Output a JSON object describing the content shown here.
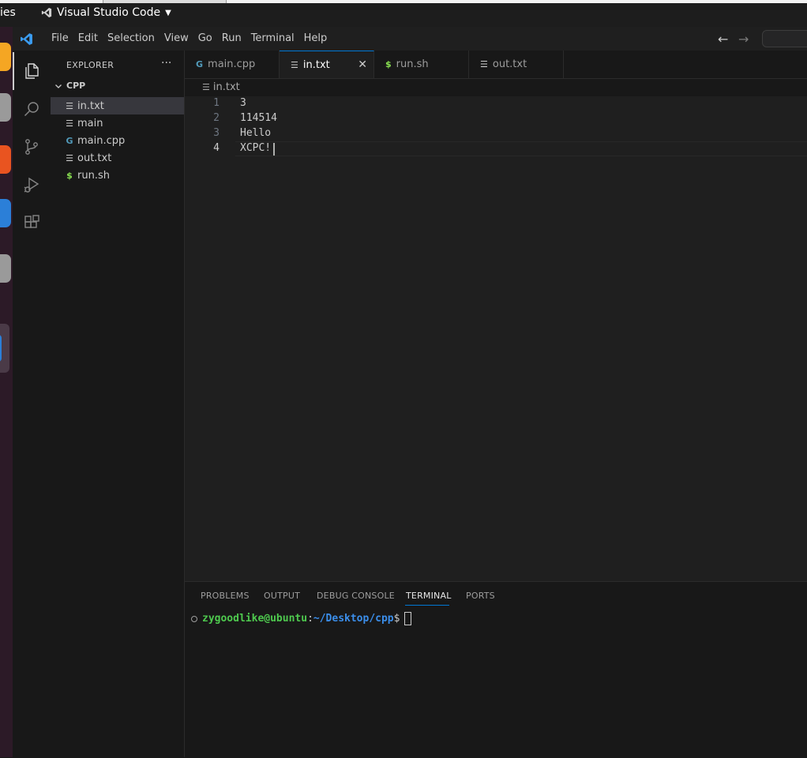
{
  "os": {
    "activities_label": "ies",
    "app_name": "Visual Studio Code",
    "dock_colors": [
      "#f5a623",
      "#9a9a9a",
      "#e95420",
      "#2b7fd8",
      "#9a9a9a",
      "#2b7fd8"
    ]
  },
  "menu": [
    "File",
    "Edit",
    "Selection",
    "View",
    "Go",
    "Run",
    "Terminal",
    "Help"
  ],
  "activity_bar": [
    "files-icon",
    "search-icon",
    "source-control-icon",
    "run-debug-icon",
    "extensions-icon"
  ],
  "explorer": {
    "title": "EXPLORER",
    "more": "···",
    "folder": "CPP",
    "files": [
      {
        "name": "in.txt",
        "icon": "text-file-icon",
        "selected": true
      },
      {
        "name": "main",
        "icon": "text-file-icon",
        "selected": false
      },
      {
        "name": "main.cpp",
        "icon": "cpp-file-icon",
        "selected": false
      },
      {
        "name": "out.txt",
        "icon": "text-file-icon",
        "selected": false
      },
      {
        "name": "run.sh",
        "icon": "shell-file-icon",
        "selected": false
      }
    ]
  },
  "tabs": [
    {
      "label": "main.cpp",
      "icon": "cpp-file-icon",
      "active": false
    },
    {
      "label": "in.txt",
      "icon": "text-file-icon",
      "active": true
    },
    {
      "label": "run.sh",
      "icon": "shell-file-icon",
      "active": false
    },
    {
      "label": "out.txt",
      "icon": "text-file-icon",
      "active": false
    }
  ],
  "breadcrumb": "in.txt",
  "editor": {
    "lines": [
      "3",
      "114514",
      "Hello",
      "XCPC!"
    ],
    "current_line": 4
  },
  "panel": {
    "tabs": [
      "PROBLEMS",
      "OUTPUT",
      "DEBUG CONSOLE",
      "TERMINAL",
      "PORTS"
    ],
    "active_tab": "TERMINAL",
    "terminal": {
      "user": "zygoodlike@ubuntu",
      "colon": ":",
      "path": "~/Desktop/cpp",
      "prompt": "$"
    }
  },
  "colors": {
    "accent": "#0078d4",
    "cpp_icon": "#519aba",
    "shell_icon": "#89e051",
    "term_user": "#4ec94e",
    "term_path": "#3b8eea"
  }
}
